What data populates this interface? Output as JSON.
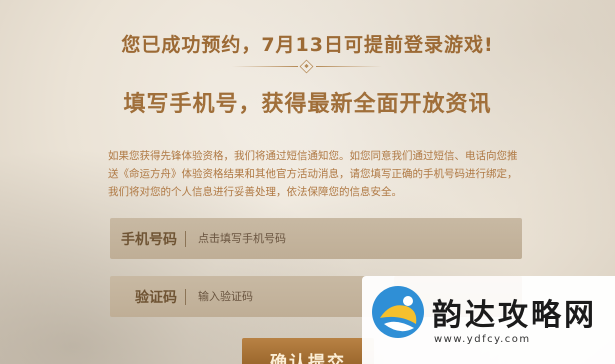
{
  "header": {
    "headline": "您已成功预约，7月13日可提前登录游戏!",
    "subhead": "填写手机号，获得最新全面开放资讯"
  },
  "notice": {
    "text": "如果您获得先锋体验资格，我们将通过短信通知您。如您同意我们通过短信、电话向您推送《命运方舟》体验资格结果和其他官方活动消息，请您填写正确的手机号码进行绑定，我们将对您的个人信息进行妥善处理，依法保障您的信息安全。"
  },
  "form": {
    "phone_label": "手机号码",
    "phone_placeholder": "点击填写手机号码",
    "phone_value": "",
    "code_label": "验证码",
    "code_placeholder": "输入验证码",
    "code_value": "",
    "confirm_label": "确认提交"
  },
  "watermark": {
    "title": "韵达攻略网",
    "url": "www.ydfcy.com"
  },
  "colors": {
    "accent": "#a06f3a",
    "field_bg": "#c6b7a1",
    "button": "#9f6b2e"
  }
}
